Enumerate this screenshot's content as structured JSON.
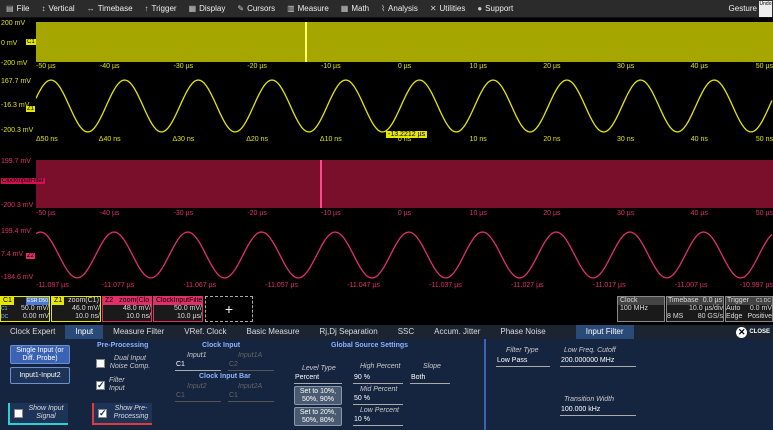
{
  "menu": [
    {
      "label": "File",
      "icon": "file-icon"
    },
    {
      "label": "Vertical",
      "icon": "vertical-icon"
    },
    {
      "label": "Timebase",
      "icon": "timebase-icon"
    },
    {
      "label": "Trigger",
      "icon": "trigger-icon"
    },
    {
      "label": "Display",
      "icon": "display-icon"
    },
    {
      "label": "Cursors",
      "icon": "cursors-icon"
    },
    {
      "label": "Measure",
      "icon": "measure-icon"
    },
    {
      "label": "Math",
      "icon": "math-icon"
    },
    {
      "label": "Analysis",
      "icon": "analysis-icon"
    },
    {
      "label": "Utilities",
      "icon": "utilities-icon"
    },
    {
      "label": "Support",
      "icon": "support-icon"
    }
  ],
  "gesture_label": "Gesture",
  "gesture_box": "Undo",
  "pane1": {
    "y": [
      "200 mV",
      "0 mV",
      "-200 mV"
    ],
    "tag": "C1",
    "x": [
      "-50 µs",
      "-40 µs",
      "-30 µs",
      "-20 µs",
      "-10 µs",
      "0 µs",
      "10 µs",
      "20 µs",
      "30 µs",
      "40 µs",
      "50 µs"
    ]
  },
  "pane2": {
    "y": [
      "167.7 mV",
      "-16.3 mV",
      "-200.3 mV"
    ],
    "tag": "Z1",
    "cursor": "-13.2212 µs",
    "x": [
      "Δ50 ns",
      "Δ40 ns",
      "Δ30 ns",
      "Δ20 ns",
      "Δ10 ns",
      "0 ns",
      "10 ns",
      "20 ns",
      "30 ns",
      "40 ns",
      "50 ns"
    ]
  },
  "pane3": {
    "y": [
      "199.7 mV",
      "-200.3 mV"
    ],
    "tag": "ClockInputFilter",
    "x": [
      "-50 µs",
      "-40 µs",
      "-30 µs",
      "-20 µs",
      "-10 µs",
      "0 µs",
      "10 µs",
      "20 µs",
      "30 µs",
      "40 µs",
      "50 µs"
    ]
  },
  "pane4": {
    "y": [
      "199.4 mV",
      "7.4 mV",
      "-184.6 mV"
    ],
    "tag": "Z2",
    "x": [
      "-11.087 µs",
      "-11.077 µs",
      "-11.067 µs",
      "-11.057 µs",
      "-11.047 µs",
      "-11.037 µs",
      "-11.027 µs",
      "-11.017 µs",
      "-11.007 µs",
      "-10.997 µs"
    ]
  },
  "descriptors": {
    "c1": {
      "name": "C1",
      "badge": "ESR D50",
      "sub1": "C1",
      "sub2": "DC",
      "v1": "50.0 mV/",
      "v2": "0.00 mV"
    },
    "z1": {
      "name": "Z1",
      "title": "zoom(C1)",
      "v1": "46.0 mV/",
      "v2": "10.0 ns/"
    },
    "z2": {
      "name": "Z2",
      "title": "zoom(Clo",
      "v1": "48.0 mV/",
      "v2": "10.0 ns/"
    },
    "clk": {
      "name": "ClockInputFilter",
      "v1": "50.0 mV/",
      "v2": "10.0 µs/"
    },
    "add": "+",
    "clock": {
      "title": "Clock",
      "v1": "100 MHz"
    },
    "timebase": {
      "title": "Timebase",
      "a": "0.0 µs",
      "b": "10.0 µs/div",
      "c": "8 MS",
      "d": "80 GS/s"
    },
    "trigger": {
      "title": "Trigger",
      "badge": "C1 DC",
      "a": "Auto",
      "b": "0.0 mV",
      "c": "Edge",
      "d": "Positive"
    }
  },
  "tabs": [
    "Clock Expert",
    "Input",
    "Measure Filter",
    "VRef. Clock",
    "Basic Measure",
    "Rj,Dj Separation",
    "SSC",
    "Accum. Jitter",
    "Phase Noise",
    "Input Filter"
  ],
  "close_label": "CLOSE",
  "panel": {
    "single_input": "Single Input (or Diff. Probe)",
    "input1_input2": "Input1-Input2",
    "show_input_signal": "Show Input Signal",
    "preproc_title": "Pre-Processing",
    "dual_input": "Dual Input Noise Comp.",
    "filter_input": "Filter Input",
    "show_preproc": "Show Pre-Processing",
    "clock_input_title": "Clock Input",
    "input1": "Input1",
    "input1_val": "C1",
    "input1a": "Input1A",
    "input1a_val": "C2",
    "clock_input_bar": "Clock Input Bar",
    "input2": "Input2",
    "input2_val": "C1",
    "input2a": "Input2A",
    "input2a_val": "C1",
    "global_title": "Global Source Settings",
    "level_type": "Level Type",
    "level_type_val": "Percent",
    "high_percent": "High Percent",
    "high_percent_val": "90 %",
    "slope": "Slope",
    "slope_val": "Both",
    "set_10": "Set to 10%, 50%, 90%",
    "mid_percent": "Mid Percent",
    "mid_percent_val": "50 %",
    "set_20": "Set to 20%, 50%, 80%",
    "low_percent": "Low Percent",
    "low_percent_val": "10 %",
    "filter_type": "Filter Type",
    "filter_type_val": "Low Pass",
    "low_freq": "Low Freq. Cutoff",
    "low_freq_val": "200.000000 MHz",
    "transition": "Transition Width",
    "transition_val": "100.000 kHz"
  }
}
